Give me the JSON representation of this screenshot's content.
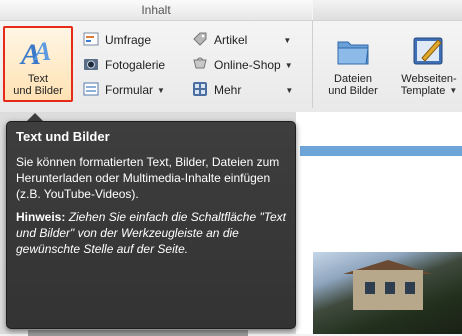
{
  "ribbon": {
    "group_label": "Inhalt",
    "big_buttons": [
      {
        "label_line1": "Text",
        "label_line2": "und Bilder",
        "icon": "text-images-icon"
      },
      {
        "label_line1": "Dateien",
        "label_line2": "und Bilder",
        "icon": "folder-icon"
      },
      {
        "label_line1": "Webseiten-",
        "label_line2": "Template",
        "icon": "template-icon"
      }
    ],
    "small_buttons": [
      {
        "label": "Umfrage",
        "icon": "poll-icon"
      },
      {
        "label": "Fotogalerie",
        "icon": "photo-gallery-icon"
      },
      {
        "label": "Formular",
        "icon": "form-icon"
      },
      {
        "label": "Artikel",
        "icon": "tag-icon"
      },
      {
        "label": "Online-Shop",
        "icon": "shop-icon"
      },
      {
        "label": "Mehr",
        "icon": "more-icon"
      }
    ]
  },
  "tooltip": {
    "title": "Text und Bilder",
    "body": "Sie können formatierten Text, Bilder, Dateien zum Herunterladen oder Multimedia-Inhalte einfügen (z.B. YouTube-Videos).",
    "hint_label": "Hinweis:",
    "hint_text": "Ziehen Sie einfach die Schaltfläche \"Text und Bilder\" von der Werkzeugleiste an die gewünschte Stelle auf der Seite."
  },
  "colors": {
    "active_border": "#e52a1a",
    "tooltip_bg": "#3a3a3a"
  }
}
